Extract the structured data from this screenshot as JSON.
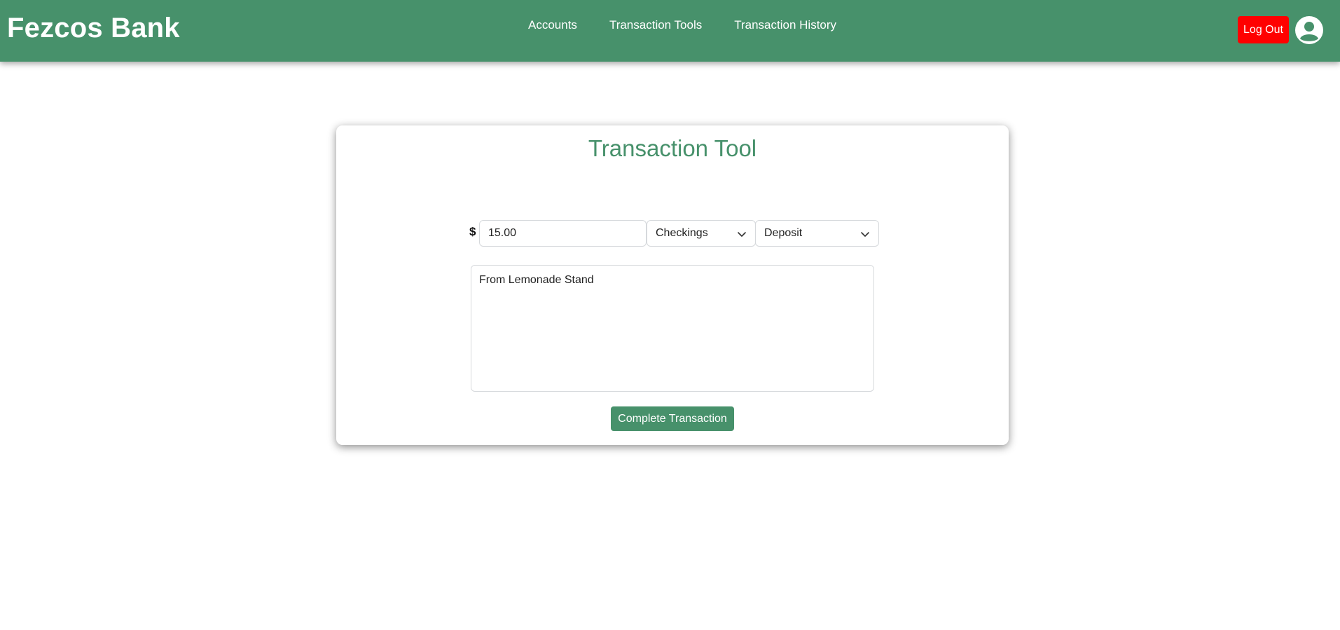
{
  "header": {
    "brand": "Fezcos Bank",
    "nav": [
      {
        "label": "Accounts"
      },
      {
        "label": "Transaction Tools"
      },
      {
        "label": "Transaction History"
      }
    ],
    "logout_label": "Log Out",
    "avatar_icon": "user-circle-icon",
    "colors": {
      "bar": "#47916b",
      "logout": "#ff0000"
    }
  },
  "card": {
    "title": "Transaction Tool",
    "currency_symbol": "$",
    "amount_value": "15.00",
    "account_selected": "Checkings",
    "type_selected": "Deposit",
    "memo_value": "From Lemonade Stand",
    "submit_label": "Complete Transaction",
    "chevron_icon": "chevron-down-icon"
  }
}
